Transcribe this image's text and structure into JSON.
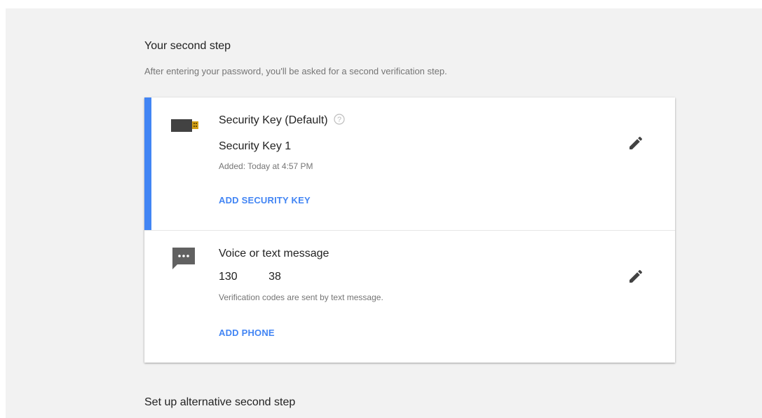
{
  "section": {
    "title": "Your second step",
    "description": "After entering your password, you'll be asked for a second verification step."
  },
  "methods": [
    {
      "title": "Security Key (Default)",
      "icon": "usb-key-icon",
      "value": "Security Key 1",
      "note": "Added: Today at 4:57 PM",
      "action": "ADD SECURITY KEY",
      "selected": true
    },
    {
      "title": "Voice or text message",
      "icon": "message-icon",
      "value": "130          38",
      "note": "Verification codes are sent by text message.",
      "action": "ADD PHONE",
      "selected": false
    }
  ],
  "alternative": {
    "title": "Set up alternative second step"
  },
  "colors": {
    "accent": "#4285f4",
    "background": "#f2f2f2",
    "card": "#ffffff"
  }
}
